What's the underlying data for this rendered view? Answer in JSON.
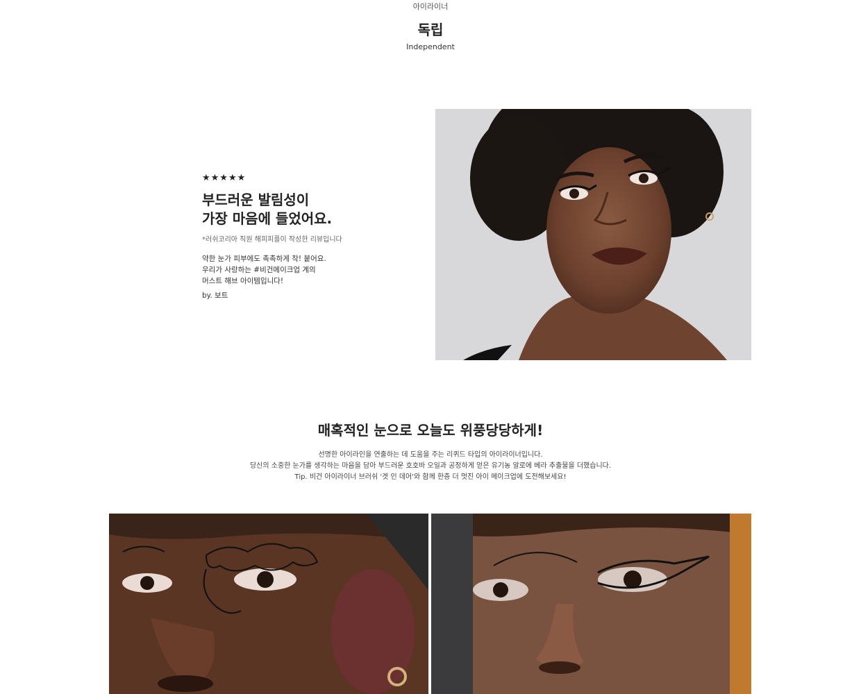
{
  "header": {
    "category": "아이라이너",
    "title": "독립",
    "subtitle": "Independent"
  },
  "review": {
    "rating": "★★★★★",
    "headline_line1": "부드러운 발림성이",
    "headline_line2": "가장 마음에 들었어요.",
    "note": "*러쉬코리아 직원 해피피플이 작성한 리뷰입니다",
    "body_line1": "약한 눈가 피부에도 촉촉하게 착! 붙어요.",
    "body_line2": "우리가 사랑하는 #비건메이크업 계의",
    "body_line3": "머스트 해브 아이템입니다!",
    "author": "by. 보트"
  },
  "feature": {
    "title": "매혹적인 눈으로 오늘도 위풍당당하게!",
    "desc_line1": "선명한 아이라인을 연출하는 데 도움을 주는 리퀴드 타입의 아이라이너입니다.",
    "desc_line2": "당신의 소중한 눈가를 생각하는 마음을 담아 부드러운 호호바 오일과 공정하게 얻은 유기농 알로에 베라 추출물을 더했습니다.",
    "desc_line3": "Tip. 비건 아이라이너 브러쉬 '겟 인 데어'와 함께 한층 더 멋진 아이 메이크업에 도전해보세요!"
  }
}
